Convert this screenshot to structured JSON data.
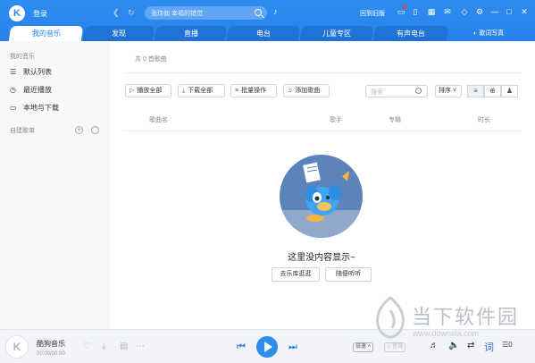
{
  "topbar": {
    "login_label": "登录",
    "search_placeholder": "张玮伽 幸福的错觉",
    "old_version_label": "回到旧版",
    "icons": [
      "mail-icon",
      "skin-icon",
      "settings-icon",
      "minimize-icon",
      "maximize-icon",
      "close-icon"
    ]
  },
  "tabs": [
    {
      "label": "我的音乐",
      "active": true
    },
    {
      "label": "发现",
      "active": false
    },
    {
      "label": "直播",
      "active": false
    },
    {
      "label": "电台",
      "active": false
    },
    {
      "label": "儿童专区",
      "active": false
    },
    {
      "label": "有声电台",
      "active": false
    }
  ],
  "gift_label": "歌词写真",
  "sidebar": {
    "heading": "我的音乐",
    "items": [
      {
        "label": "默认列表",
        "icon": "list-icon"
      },
      {
        "label": "最近播放",
        "icon": "clock-icon"
      },
      {
        "label": "本地与下载",
        "icon": "monitor-icon"
      }
    ],
    "playlist_heading": "自建歌单"
  },
  "main": {
    "song_count": "共 0 首歌曲",
    "toolbar": {
      "play_all": "播放全部",
      "download_all": "下载全部",
      "batch": "批量操作",
      "add_song": "添加歌曲"
    },
    "filter_placeholder": "搜索",
    "sort_label": "排序",
    "columns": {
      "song": "歌曲名",
      "artist": "歌手",
      "album": "专辑",
      "duration": "时长"
    },
    "empty_text": "这里没内容显示~",
    "empty_buttons": {
      "go_library": "去乐库逛逛",
      "random_listen": "随便听听"
    }
  },
  "player": {
    "title": "酷狗音乐",
    "time": "00:00/00:00",
    "speed_label": "倍速",
    "sound_label": "音效",
    "lyric_label": "词",
    "queue_count": "0"
  },
  "watermark": {
    "title": "当下软件园",
    "url": "www.downxia.com"
  },
  "colors": {
    "accent": "#2682ea",
    "topbar": "#2e8cf0",
    "empty_art": "#5d83bb"
  }
}
